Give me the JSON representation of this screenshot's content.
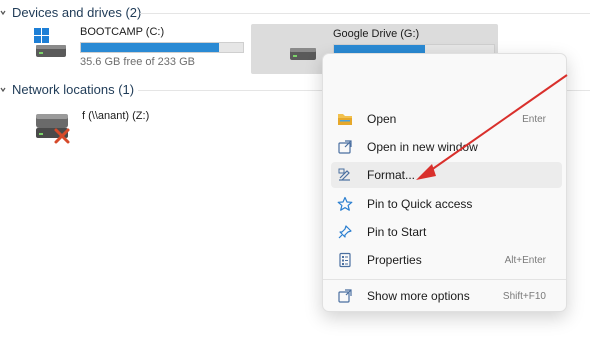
{
  "sections": {
    "devices": {
      "title": "Devices and drives (2)"
    },
    "network": {
      "title": "Network locations (1)"
    }
  },
  "drives": {
    "c": {
      "name": "BOOTCAMP (C:)",
      "free_text": "35.6 GB free of 233 GB",
      "used_fraction": 0.85,
      "icon": "windows-drive-icon"
    },
    "g": {
      "name": "Google Drive (G:)",
      "used_fraction": 0.57,
      "icon": "hard-drive-icon"
    },
    "net": {
      "name": "f (\\\\anant) (Z:)",
      "icon": "disconnected-network-drive-icon"
    }
  },
  "context_menu": {
    "items": [
      {
        "label": "Open",
        "shortcut": "Enter",
        "icon": "folder-open-icon"
      },
      {
        "label": "Open in new window",
        "shortcut": "",
        "icon": "new-window-icon"
      },
      {
        "label": "Format...",
        "shortcut": "",
        "icon": "format-drive-icon"
      },
      {
        "label": "Pin to Quick access",
        "shortcut": "",
        "icon": "star-icon"
      },
      {
        "label": "Pin to Start",
        "shortcut": "",
        "icon": "pin-icon"
      },
      {
        "label": "Properties",
        "shortcut": "Alt+Enter",
        "icon": "properties-icon"
      },
      {
        "label": "Show more options",
        "shortcut": "Shift+F10",
        "icon": "more-options-icon"
      }
    ]
  },
  "colors": {
    "accent": "#2a8ad4",
    "selection": "#dcdcdc",
    "arrow": "#d9302c"
  }
}
